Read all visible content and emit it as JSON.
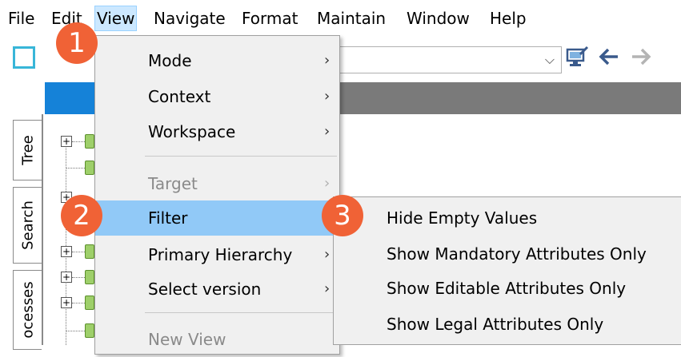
{
  "menubar": {
    "items": [
      "File",
      "Edit",
      "View",
      "Navigate",
      "Format",
      "Maintain",
      "Window",
      "Help"
    ],
    "active": "View"
  },
  "toolbar": {
    "icons": [
      "workspace-square-icon",
      "monitor-edit-icon",
      "back-arrow-icon",
      "forward-arrow-icon"
    ],
    "combo_arrow": "⌵"
  },
  "left_tabs": [
    "Tree",
    "Search",
    "ocesses"
  ],
  "view_menu": {
    "items": [
      {
        "label": "Mode",
        "submenu": true,
        "disabled": false
      },
      {
        "label": "Context",
        "submenu": true,
        "disabled": false
      },
      {
        "label": "Workspace",
        "submenu": true,
        "disabled": false
      },
      {
        "label": "Target",
        "submenu": true,
        "disabled": true
      },
      {
        "label": "Filter",
        "submenu": true,
        "disabled": false,
        "highlighted": true
      },
      {
        "label": "Primary Hierarchy",
        "submenu": true,
        "disabled": false
      },
      {
        "label": "Select version",
        "submenu": true,
        "disabled": false
      },
      {
        "label": "New View",
        "submenu": false,
        "disabled": true
      }
    ],
    "arrow": "›"
  },
  "filter_submenu": {
    "items": [
      "Hide Empty Values",
      "Show Mandatory Attributes Only",
      "Show Editable Attributes Only",
      "Show Legal Attributes Only"
    ]
  },
  "badges": [
    "1",
    "2",
    "3"
  ],
  "colors": {
    "badge": "#f06236",
    "menu_highlight": "#91c9f7",
    "menubar_active": "#cce8ff",
    "header_blue": "#1582d8",
    "header_gray": "#7a7a7a"
  }
}
